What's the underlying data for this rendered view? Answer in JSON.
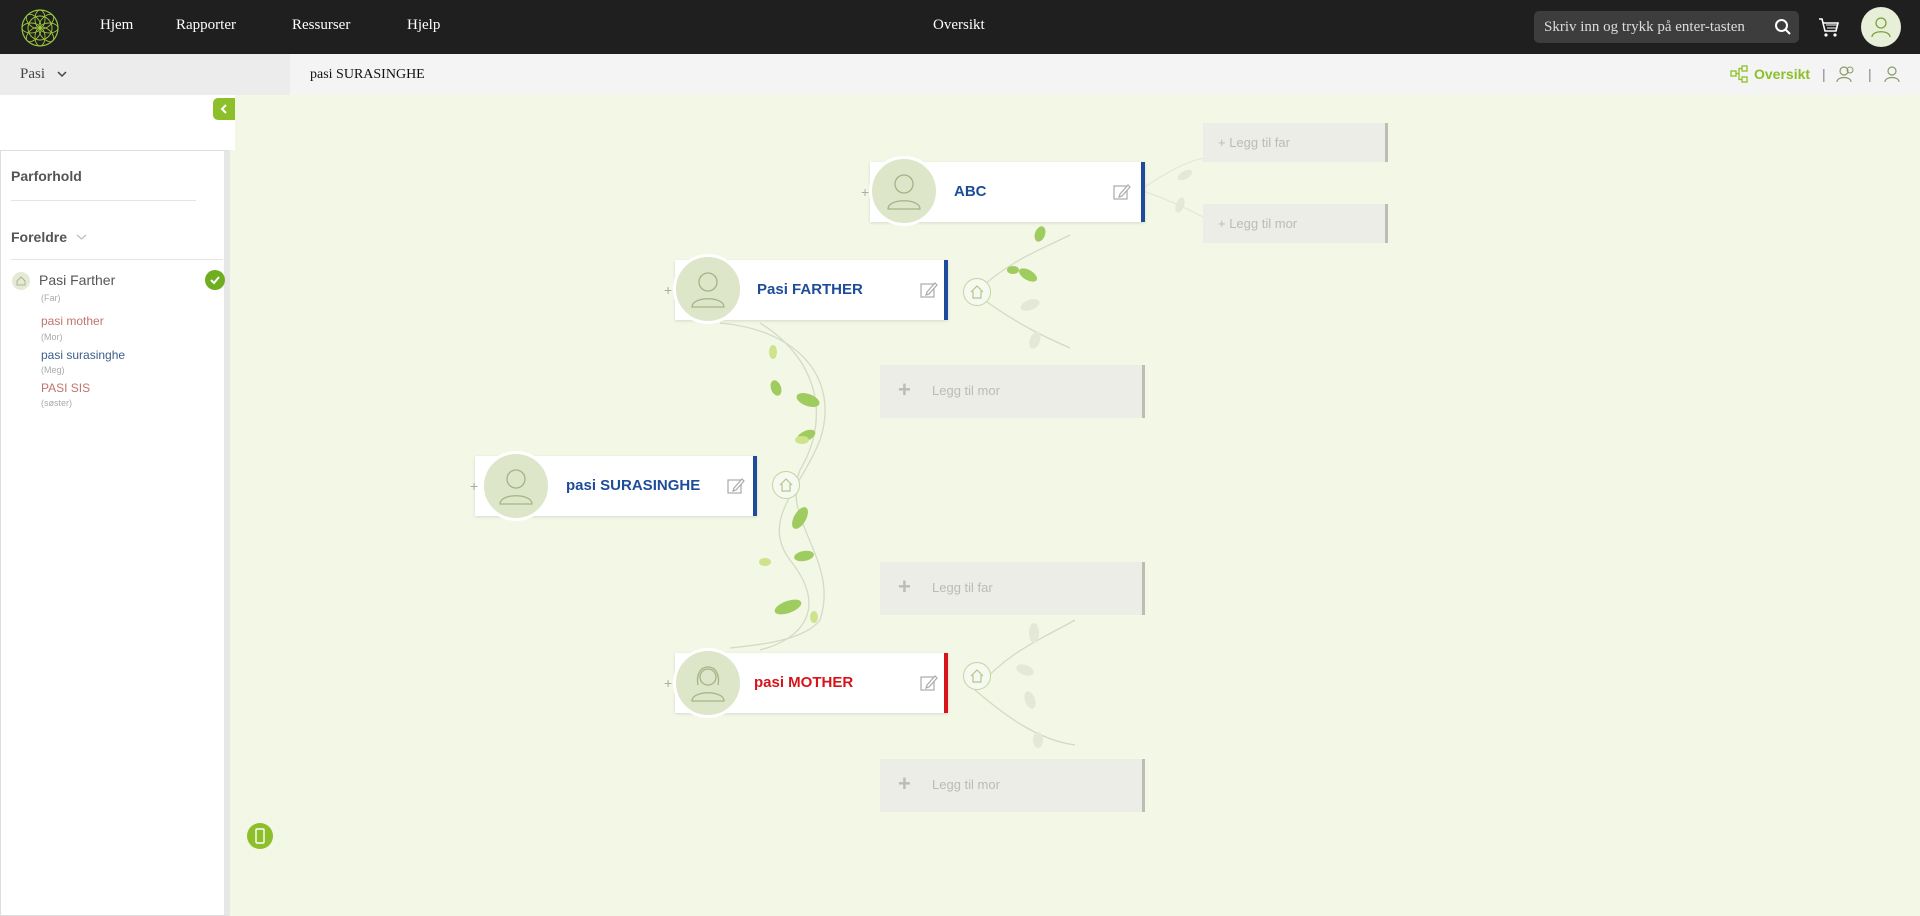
{
  "nav": {
    "items": [
      "Hjem",
      "Rapporter",
      "Ressurser",
      "Hjelp"
    ],
    "center_title": "Oversikt",
    "search_placeholder": "Skriv inn og trykk på enter-tasten"
  },
  "subheader": {
    "selector": "Pasi",
    "page_title": "pasi SURASINGHE",
    "view_link": "Oversikt",
    "separator": "|"
  },
  "sidebar": {
    "title": "Parforhold",
    "section": "Foreldre",
    "parent": {
      "name": "Pasi Farther",
      "relation": "(Far)"
    },
    "children": [
      {
        "name": "pasi mother",
        "relation": "(Mor)",
        "color": "#c0756a"
      },
      {
        "name": "pasi surasinghe",
        "relation": "(Meg)",
        "color": "#3b5f8a"
      },
      {
        "name": "PASI SIS",
        "relation": "(søster)",
        "color": "#c0756a"
      }
    ]
  },
  "tree": {
    "self": {
      "name": "pasi SURASINGHE",
      "color": "#1e4c9a"
    },
    "father": {
      "name": "Pasi FARTHER",
      "color": "#1e4c9a"
    },
    "mother": {
      "name": "pasi MOTHER",
      "color": "#d8141b"
    },
    "grandfather": {
      "name": "ABC",
      "color": "#1e4c9a"
    },
    "add_mother_label": "Legg til mor",
    "add_father_label": "Legg til far",
    "add_far_small": "+ Legg til far",
    "add_mor_small": "+ Legg til mor",
    "plus": "+"
  },
  "colors": {
    "accent": "#8cbf2a",
    "male_bar": "#1e4c9a",
    "female_bar": "#d8141b",
    "topbar": "#1f1f1f",
    "canvas": "#f3f7e6"
  }
}
